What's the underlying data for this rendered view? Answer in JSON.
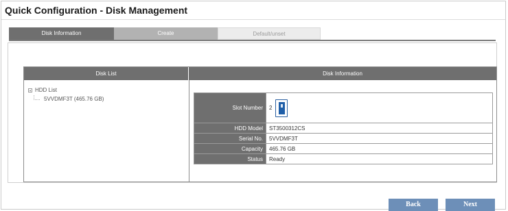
{
  "page_title": "Quick Configuration - Disk Management",
  "tabs": [
    {
      "label": "Disk Information"
    },
    {
      "label": "Create"
    },
    {
      "label": "Default/unset"
    }
  ],
  "disk_list": {
    "header": "Disk List",
    "root": "HDD List",
    "items": [
      {
        "label": "5VVDMF3T (465.76 GB)"
      }
    ]
  },
  "disk_info": {
    "header": "Disk Information",
    "slot_label": "Slot Number",
    "slot_value": "2",
    "hdd_model_label": "HDD Model",
    "hdd_model_value": "ST3500312CS",
    "serial_label": "Serial No.",
    "serial_value": "5VVDMF3T",
    "capacity_label": "Capacity",
    "capacity_value": "465.76 GB",
    "status_label": "Status",
    "status_value": "Ready",
    "status_color": "#2aa12a"
  },
  "buttons": {
    "back": "Back",
    "next": "Next"
  },
  "colors": {
    "tab_active": "#6f6f6f",
    "button": "#6d8fb8",
    "drive_icon": "#1e5ea8"
  }
}
